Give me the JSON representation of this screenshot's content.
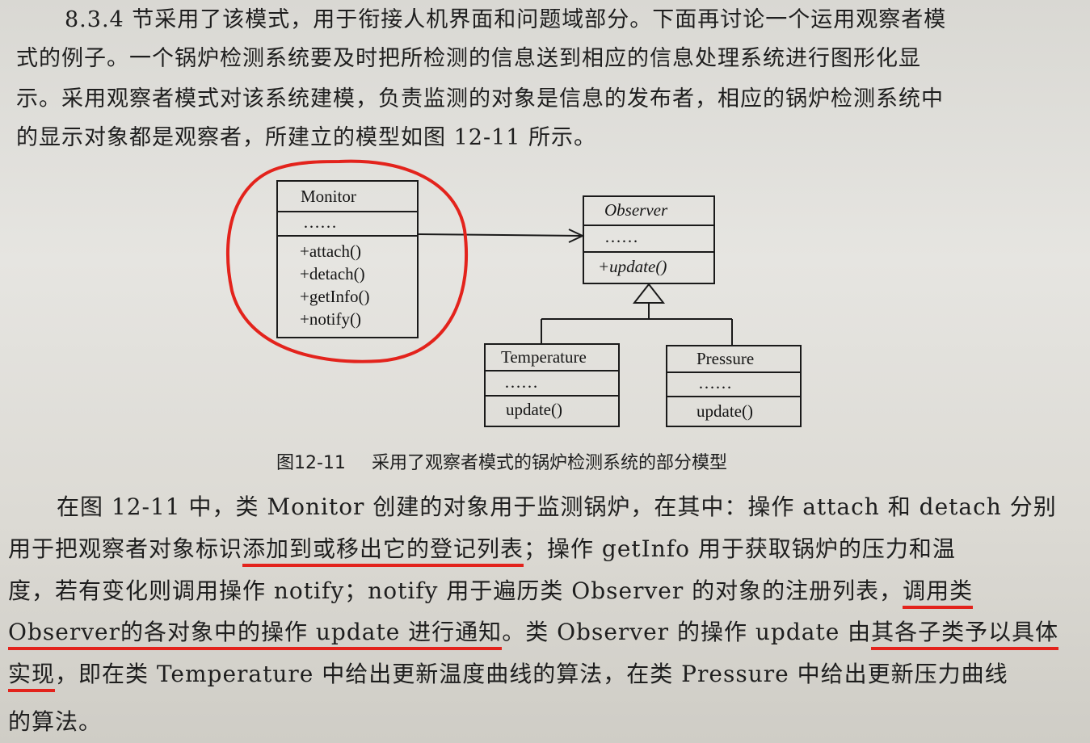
{
  "paragraph_top": [
    "8.3.4 节采用了该模式，用于衔接人机界面和问题域部分。下面再讨论一个运用观察者模",
    "式的例子。一个锅炉检测系统要及时把所检测的信息送到相应的信息处理系统进行图形化显",
    "示。采用观察者模式对该系统建模，负责监测的对象是信息的发布者，相应的锅炉检测系统中",
    "的显示对象都是观察者，所建立的模型如图 12-11 所示。"
  ],
  "diagram": {
    "monitor": {
      "name": "Monitor",
      "attrs": "……",
      "ops": [
        "+attach()",
        "+detach()",
        "+getInfo()",
        "+notify()"
      ]
    },
    "observer": {
      "name": "Observer",
      "attrs": "……",
      "ops": [
        "+update()"
      ]
    },
    "temperature": {
      "name": "Temperature",
      "attrs": "……",
      "ops": [
        "update()"
      ]
    },
    "pressure": {
      "name": "Pressure",
      "attrs": "……",
      "ops": [
        "update()"
      ]
    }
  },
  "caption": {
    "number": "图12-11",
    "text": "采用了观察者模式的锅炉检测系统的部分模型"
  },
  "paragraph_bottom": {
    "l1": "在图 12-11 中，类 Monitor 创建的对象用于监测锅炉，在其中：操作 attach 和 detach 分别",
    "l2a": "用于把观察者对象标识",
    "l2b": "添加到或移出它的登记列表",
    "l2c": "；操作 getInfo 用于获取锅炉的压力和温",
    "l3a": "度，若有变化则调用操作 notify；notify 用于遍历类 Observer 的对象的注册列表，",
    "l3b": "调用类",
    "l4a": "Observer的各对象中的操作 update 进行通知",
    "l4b": "。类 Observer 的操作 update 由",
    "l4c": "其各子类予以具体",
    "l5a": "实现",
    "l5b": "，即在类 Temperature 中给出更新温度曲线的算法，在类 Pressure 中给出更新压力曲线",
    "l6": "的算法。"
  },
  "colors": {
    "annotation_red": "#e3231c",
    "ink": "#1e1e1e",
    "paper": "#e0dfda"
  }
}
